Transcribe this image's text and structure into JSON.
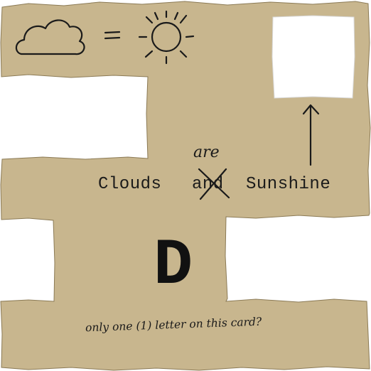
{
  "card": {
    "caption_left": "Clouds",
    "caption_struck": "and",
    "caption_correction": "are",
    "caption_right": "Sunshine",
    "letter": "D",
    "question": "only one (1) letter on this card?",
    "paper_color": "#c8b68e",
    "ink_color": "#1a1a1a"
  },
  "icons": {
    "left": "cloud-icon",
    "middle": "equals-sign",
    "right": "sun-icon",
    "pointer": "up-arrow-icon"
  }
}
